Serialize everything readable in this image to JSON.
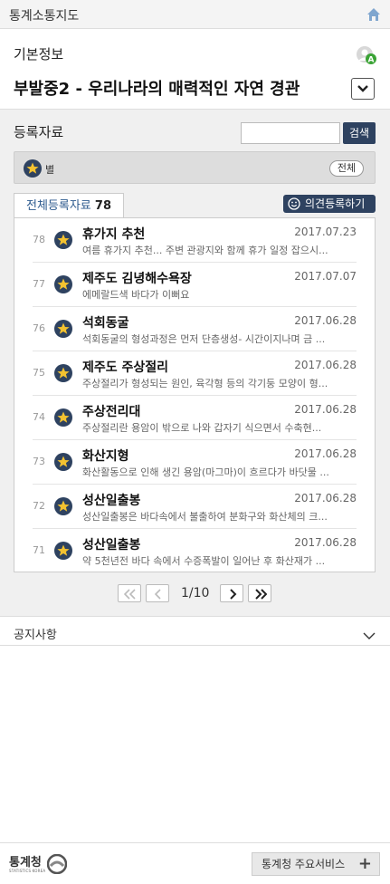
{
  "topbar": {
    "title": "통계소통지도",
    "home_icon": "home-icon"
  },
  "info": {
    "label": "기본정보",
    "map_title": "부발중2 - 우리나라의 매력적인 자연 경관",
    "badge_icon": "avatar-badge-icon",
    "dropdown_icon": "chevron-down-icon"
  },
  "registration": {
    "label": "등록자료",
    "search_value": "",
    "search_button": "검색",
    "filter_label": "별",
    "filter_all": "전체",
    "tab_label": "전체등록자료",
    "tab_count": "78",
    "opinion_button": "의견등록하기",
    "items": [
      {
        "num": "78",
        "title": "휴가지 추천",
        "date": "2017.07.23",
        "desc": "여름 휴가지 추천... 주변 관광지와 함께 휴가 일정 잡으시..."
      },
      {
        "num": "77",
        "title": "제주도 김녕해수욕장",
        "date": "2017.07.07",
        "desc": "에메랄드색 바다가 이뻐요"
      },
      {
        "num": "76",
        "title": "석회동굴",
        "date": "2017.06.28",
        "desc": "석회동굴의 형성과정은 먼저 단층생성- 시간이지나며 금 ..."
      },
      {
        "num": "75",
        "title": "제주도 주상절리",
        "date": "2017.06.28",
        "desc": "주상절리가 형성되는 원인, 육각형 등의 각기둥 모양이 형..."
      },
      {
        "num": "74",
        "title": "주상전리대",
        "date": "2017.06.28",
        "desc": "주상절리란 용암이 밖으로 나와 갑자기 식으면서 수축현..."
      },
      {
        "num": "73",
        "title": "화산지형",
        "date": "2017.06.28",
        "desc": "화산활동으로 인해 생긴 용암(마그마)이 흐르다가 바닷물 ..."
      },
      {
        "num": "72",
        "title": "성산일출봉",
        "date": "2017.06.28",
        "desc": "성산일출봉은 바다속에서 불출하여 분화구와 화산체의 크..."
      },
      {
        "num": "71",
        "title": "성산일출봉",
        "date": "2017.06.28",
        "desc": "약 5천년전 바다 속에서 수증폭발이 일어난 후 화산재가 ..."
      }
    ],
    "pagination": {
      "current": "1/10"
    }
  },
  "notice": {
    "label": "공지사항"
  },
  "footer": {
    "logo_text": "통계청",
    "logo_sub": "STATISTICS KOREA",
    "service_button": "통계청 주요서비스",
    "plus": "+"
  },
  "colors": {
    "accent": "#2e4260",
    "tab_text": "#2d5a8e",
    "star": "#f3c230"
  }
}
